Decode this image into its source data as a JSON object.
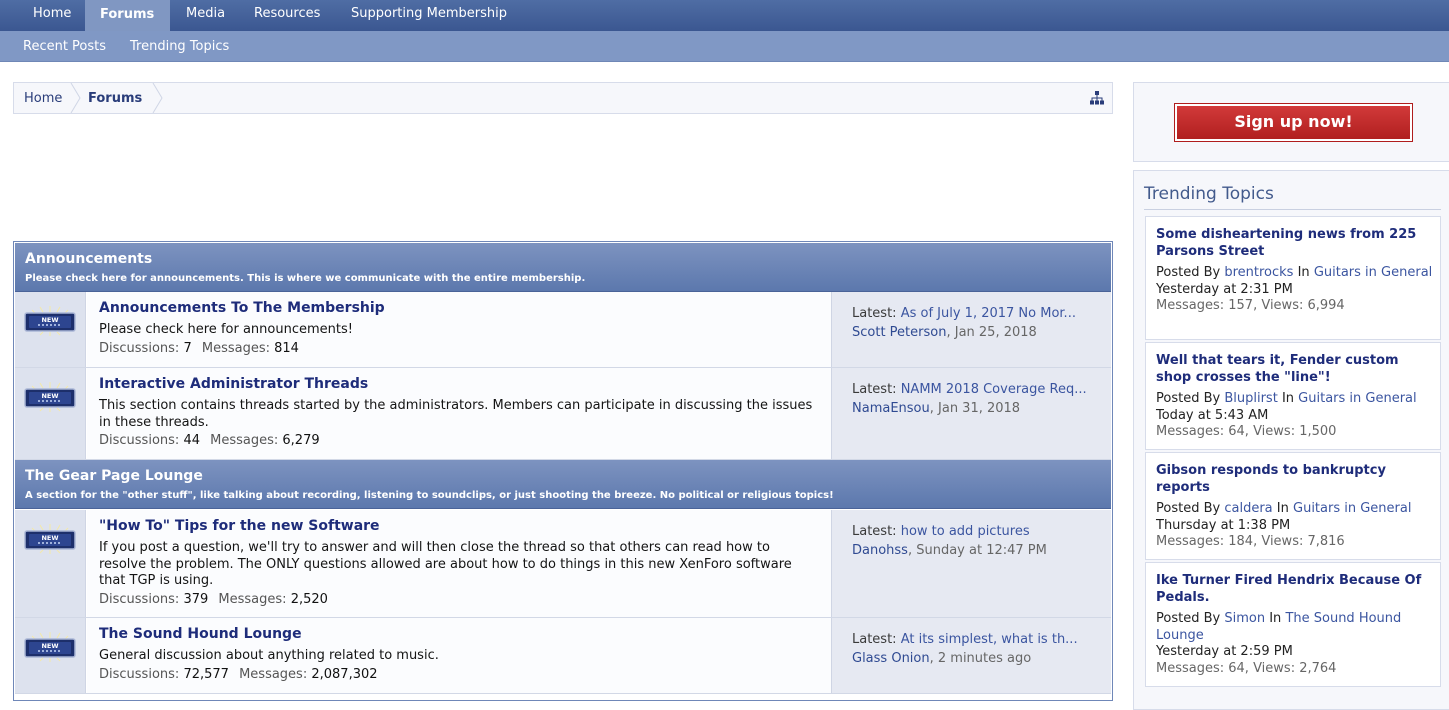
{
  "nav": {
    "tabs": [
      {
        "label": "Home"
      },
      {
        "label": "Forums"
      },
      {
        "label": "Media"
      },
      {
        "label": "Resources"
      },
      {
        "label": "Supporting Membership"
      }
    ],
    "active_tab": "Forums",
    "sub_tabs": [
      {
        "label": "Recent Posts"
      },
      {
        "label": "Trending Topics"
      }
    ]
  },
  "breadcrumb": {
    "items": [
      "Home",
      "Forums"
    ]
  },
  "categories": [
    {
      "title": "Announcements",
      "description": "Please check here for announcements. This is where we communicate with the entire membership."
    },
    {
      "title": "The Gear Page Lounge",
      "description": "A section for the \"other stuff\", like talking about recording, listening to soundclips, or just shooting the breeze. No political or religious topics!"
    }
  ],
  "forums": [
    {
      "title": "Announcements To The Membership",
      "description": "Please check here for announcements!",
      "discussions_label": "Discussions:",
      "discussions": "7",
      "messages_label": "Messages:",
      "messages": "814",
      "latest_label": "Latest:",
      "latest_title": "As of July 1, 2017 No Mor...",
      "latest_user": "Scott Peterson",
      "latest_date": ", Jan 25, 2018"
    },
    {
      "title": "Interactive Administrator Threads",
      "description": "This section contains threads started by the administrators. Members can participate in discussing the issues in these threads.",
      "discussions_label": "Discussions:",
      "discussions": "44",
      "messages_label": "Messages:",
      "messages": "6,279",
      "latest_label": "Latest:",
      "latest_title": "NAMM 2018 Coverage Req...",
      "latest_user": "NamaEnsou",
      "latest_date": ", Jan 31, 2018"
    },
    {
      "title": "\"How To\" Tips for the new Software",
      "description": "If you post a question, we'll try to answer and will then close the thread so that others can read how to resolve the problem. The ONLY questions allowed are about how to do things in this new XenForo software that TGP is using.",
      "discussions_label": "Discussions:",
      "discussions": "379",
      "messages_label": "Messages:",
      "messages": "2,520",
      "latest_label": "Latest:",
      "latest_title": "how to add pictures",
      "latest_user": "Danohss",
      "latest_date": ", Sunday at 12:47 PM"
    },
    {
      "title": "The Sound Hound Lounge",
      "description": "General discussion about anything related to music.",
      "discussions_label": "Discussions:",
      "discussions": "72,577",
      "messages_label": "Messages:",
      "messages": "2,087,302",
      "latest_label": "Latest:",
      "latest_title": "At its simplest, what is th...",
      "latest_user": "Glass Onion",
      "latest_date": ", 2 minutes ago"
    }
  ],
  "new_badge": "NEW",
  "sidebar": {
    "signup_label": "Sign up now!",
    "trending_title": "Trending Topics",
    "trending": [
      {
        "title": "Some disheartening news from 225 Parsons Street",
        "posted_by": "Posted By",
        "user": "brentrocks",
        "in": "In",
        "forum": "Guitars in General",
        "time": "Yesterday at 2:31 PM",
        "stats": "Messages: 157, Views: 6,994"
      },
      {
        "title": "Well that tears it, Fender custom shop crosses the \"line\"!",
        "posted_by": "Posted By",
        "user": "Bluplirst",
        "in": "In",
        "forum": "Guitars in General",
        "time": "Today at 5:43 AM",
        "stats": "Messages: 64, Views: 1,500"
      },
      {
        "title": "Gibson responds to bankruptcy reports",
        "posted_by": "Posted By",
        "user": "caldera",
        "in": "In",
        "forum": "Guitars in General",
        "time": "Thursday at 1:38 PM",
        "stats": "Messages: 184, Views: 7,816"
      },
      {
        "title": "Ike Turner Fired Hendrix Because Of Pedals.",
        "posted_by": "Posted By",
        "user": "Simon",
        "in": "In",
        "forum": "The Sound Hound Lounge",
        "time": "Yesterday at 2:59 PM",
        "stats": "Messages: 64, Views: 2,764"
      }
    ]
  },
  "colors": {
    "nav_bg": "#3f5b94",
    "subnav_bg": "#8098c5",
    "category_bg": "#6882b6",
    "link": "#1e2c7a",
    "signup_red": "#c12c2c"
  }
}
